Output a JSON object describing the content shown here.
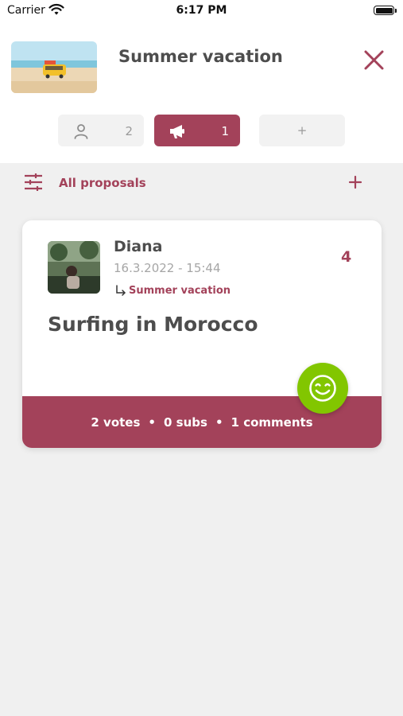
{
  "status_bar": {
    "carrier": "Carrier",
    "time": "6:17 PM"
  },
  "header": {
    "title": "Summer vacation",
    "thumbnail": "beach-van-photo",
    "close_icon": "close-icon"
  },
  "tabs": [
    {
      "icon": "person-icon",
      "count": "2",
      "selected": false
    },
    {
      "icon": "megaphone-icon",
      "count": "1",
      "selected": true
    },
    {
      "label": "+",
      "selected": false
    }
  ],
  "filter_bar": {
    "icon": "sliders-icon",
    "label": "All proposals",
    "add_icon": "plus-icon"
  },
  "proposal": {
    "author": "Diana",
    "date": "16.3.2022 - 15:44",
    "parent": "Summer vacation",
    "score": "4",
    "title": "Surfing in Morocco",
    "votes": "2 votes",
    "subs": "0 subs",
    "comments": "1 comments",
    "separator": "•"
  },
  "fab": {
    "icon": "smiley-icon"
  },
  "colors": {
    "accent": "#a3425a",
    "fab": "#82c600",
    "text": "#4d4d4d",
    "muted": "#a6a6a6",
    "background": "#f0f0f0"
  }
}
